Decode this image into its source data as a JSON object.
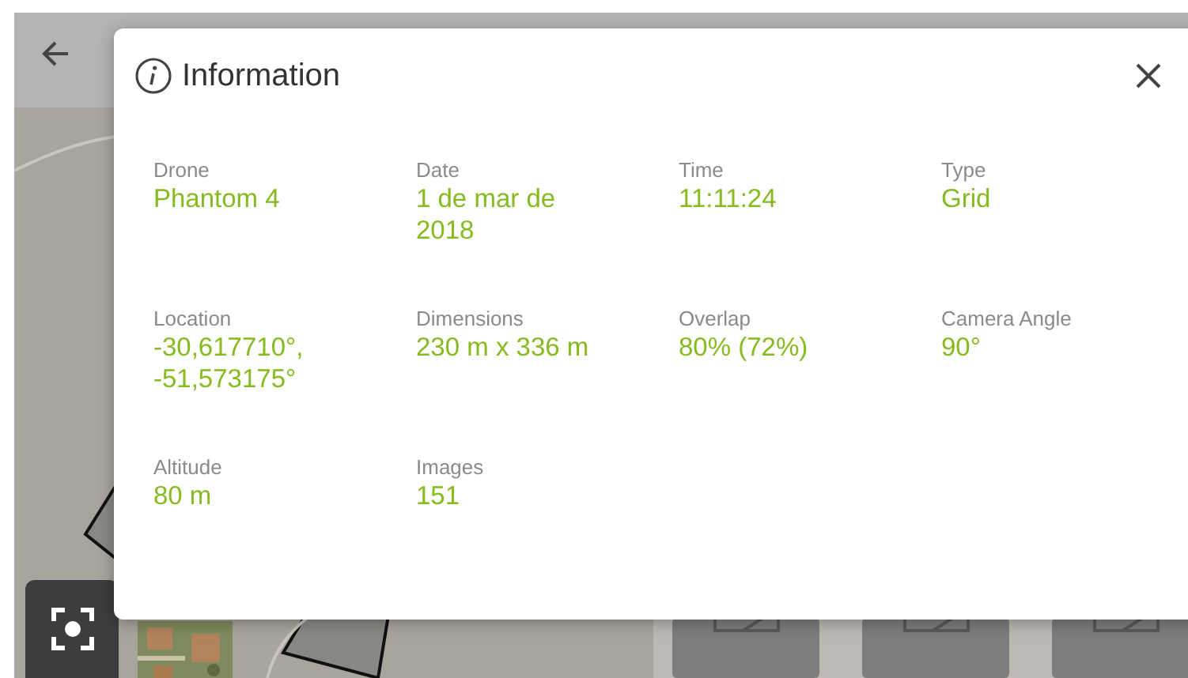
{
  "dialog": {
    "title": "Information",
    "fields": [
      {
        "label": "Drone",
        "lines": [
          "Phantom 4"
        ]
      },
      {
        "label": "Date",
        "lines": [
          "1 de mar de",
          "2018"
        ]
      },
      {
        "label": "Time",
        "lines": [
          "11:11:24"
        ]
      },
      {
        "label": "Type",
        "lines": [
          "Grid"
        ]
      },
      {
        "label": "Location",
        "lines": [
          "-30,617710°,",
          "-51,573175°"
        ]
      },
      {
        "label": "Dimensions",
        "lines": [
          "230 m x 336 m"
        ]
      },
      {
        "label": "Overlap",
        "lines": [
          "80% (72%)"
        ]
      },
      {
        "label": "Camera Angle",
        "lines": [
          "90°"
        ]
      },
      {
        "label": "Altitude",
        "lines": [
          "80 m"
        ]
      },
      {
        "label": "Images",
        "lines": [
          "151"
        ]
      }
    ]
  }
}
